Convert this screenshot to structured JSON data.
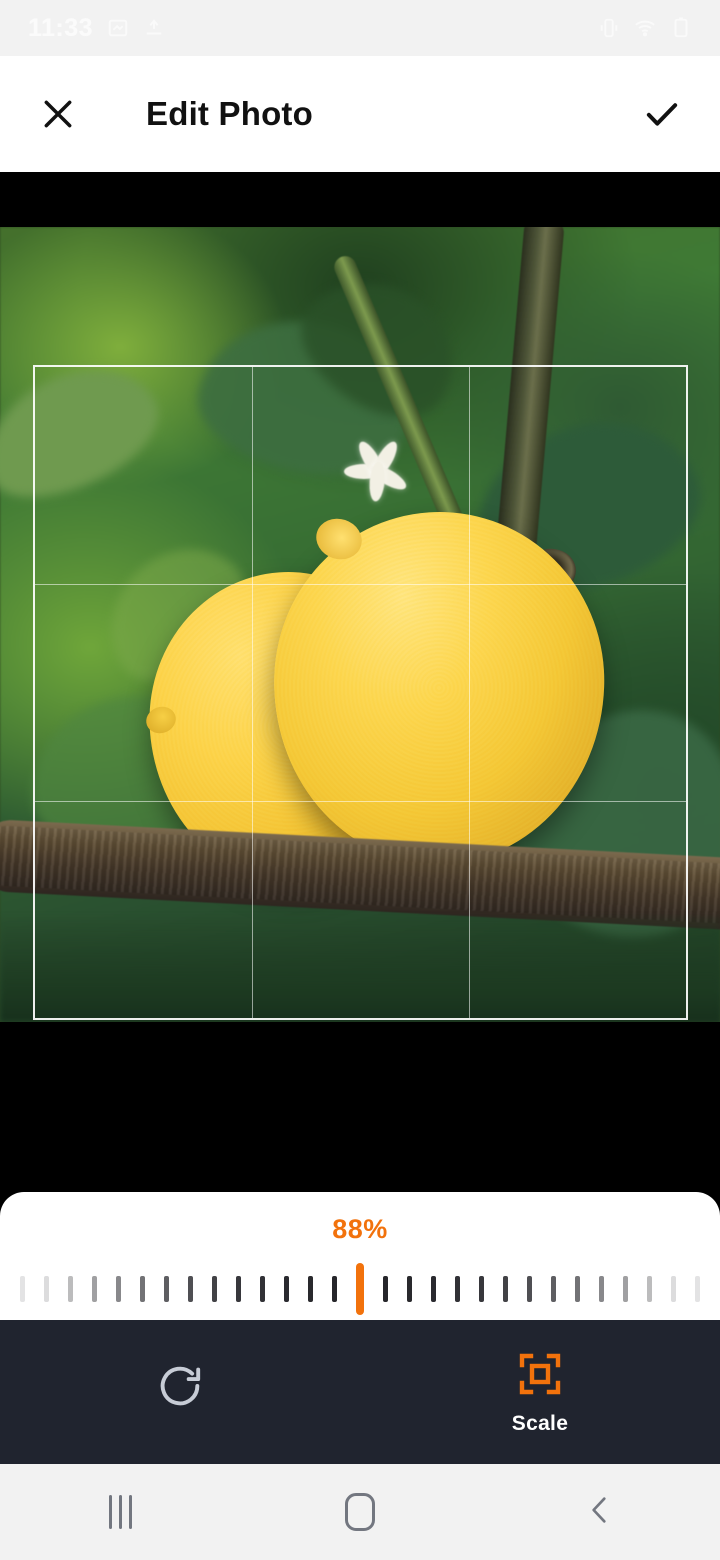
{
  "status_bar": {
    "time": "11:33",
    "left_icons": [
      "screenshot-icon",
      "share-icon"
    ],
    "right_icons": [
      "vibrate-icon",
      "wifi-icon",
      "battery-icon"
    ],
    "background_color": "#F2F2F2",
    "text_color": "#FBFBFB"
  },
  "app_bar": {
    "close_icon": "close-icon",
    "title": "Edit Photo",
    "done_icon": "check-icon",
    "background_color": "#FFFFFF",
    "title_color": "#111111"
  },
  "canvas": {
    "background_color": "#000000",
    "photo_description": "Two ripe yellow lemons hanging on a branch of a lemon tree with green blurred foliage and a small white blossom",
    "crop_overlay": {
      "grid": "rule-of-thirds",
      "columns": 3,
      "rows": 3,
      "border_color": "#FFFFFF"
    }
  },
  "slider": {
    "value_label": "88%",
    "value": 88,
    "min": 0,
    "max": 100,
    "accent_color": "#F2720C",
    "panel_color": "#FFFFFF",
    "tick_color": "#26262B",
    "ticks_left": 14,
    "ticks_right": 14
  },
  "toolbar": {
    "background_color": "#20242F",
    "items": [
      {
        "id": "rotate",
        "icon": "rotate-clockwise-icon",
        "label": "",
        "active": false,
        "color": "#C7CCD6"
      },
      {
        "id": "scale",
        "icon": "scale-icon",
        "label": "Scale",
        "active": true,
        "color": "#F2720C"
      }
    ]
  },
  "nav_bar": {
    "background_color": "#F2F2F2",
    "icon_color": "#737780",
    "buttons": [
      {
        "id": "recents",
        "icon": "recents-icon"
      },
      {
        "id": "home",
        "icon": "home-icon"
      },
      {
        "id": "back",
        "icon": "back-chevron-icon"
      }
    ]
  }
}
